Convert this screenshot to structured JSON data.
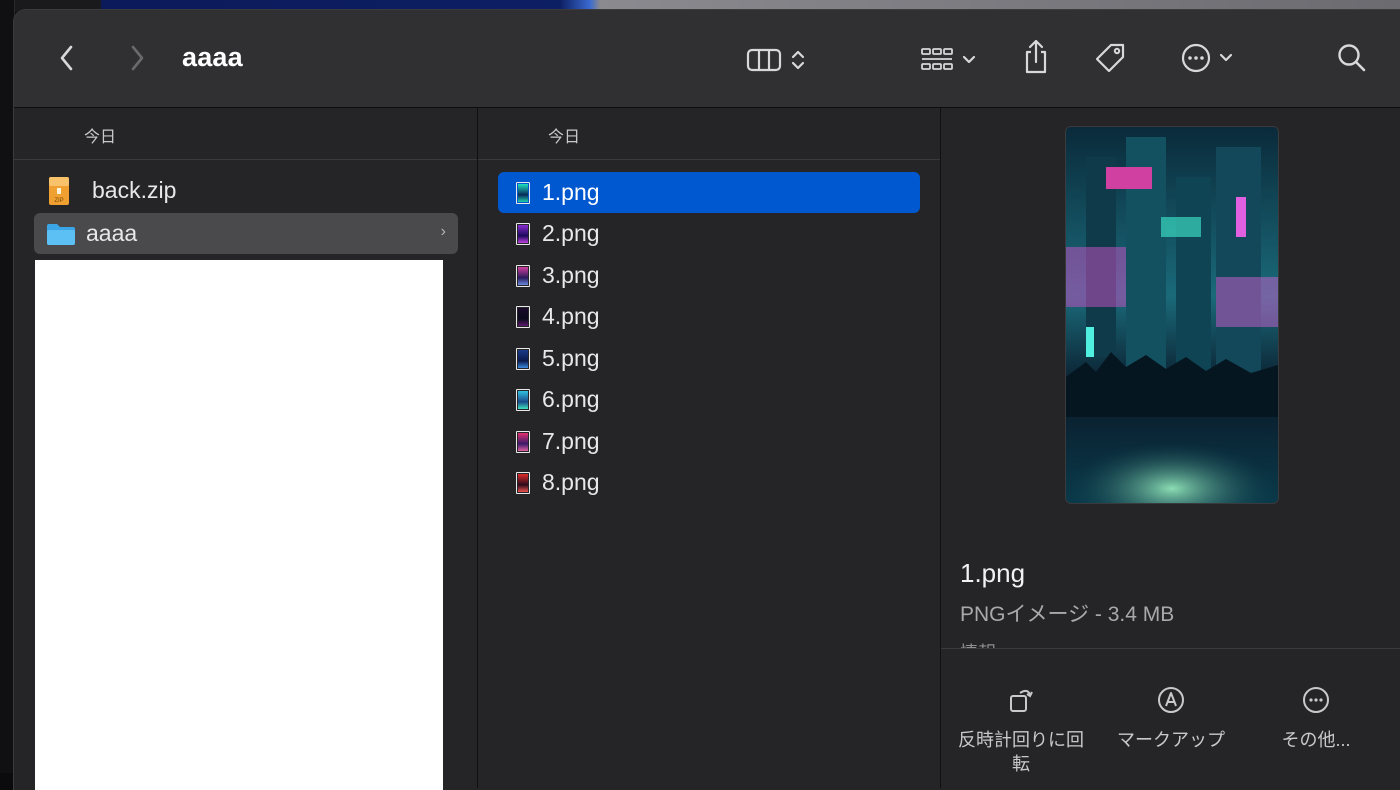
{
  "window": {
    "title": "aaaa"
  },
  "toolbar": {
    "back_icon": "chevron-left-icon",
    "forward_icon": "chevron-right-icon",
    "view_icon": "column-view-icon",
    "group_icon": "group-grid-icon",
    "share_icon": "share-icon",
    "tag_icon": "tag-icon",
    "more_icon": "ellipsis-circle-icon",
    "search_icon": "search-icon"
  },
  "column1": {
    "header": "今日",
    "items": [
      {
        "name": "back.zip",
        "icon": "zip-archive-icon"
      },
      {
        "name": "aaaa",
        "icon": "folder-icon",
        "selected": true
      }
    ]
  },
  "column2": {
    "header": "今日",
    "items": [
      {
        "name": "1.png",
        "selected": true
      },
      {
        "name": "2.png"
      },
      {
        "name": "3.png"
      },
      {
        "name": "4.png"
      },
      {
        "name": "5.png"
      },
      {
        "name": "6.png"
      },
      {
        "name": "7.png"
      },
      {
        "name": "8.png"
      }
    ]
  },
  "preview": {
    "file_name": "1.png",
    "kind_size": "PNGイメージ - 3.4 MB",
    "info_cut": "情報",
    "actions": [
      {
        "label": "反時計回りに回転",
        "icon": "rotate-left-icon"
      },
      {
        "label": "マークアップ",
        "icon": "markup-pen-icon"
      },
      {
        "label": "その他...",
        "icon": "more-ellipsis-icon"
      }
    ]
  },
  "colors": {
    "selection_blue": "#0058d1",
    "selection_gray": "#4a4a4d",
    "window_bg": "#252527"
  }
}
